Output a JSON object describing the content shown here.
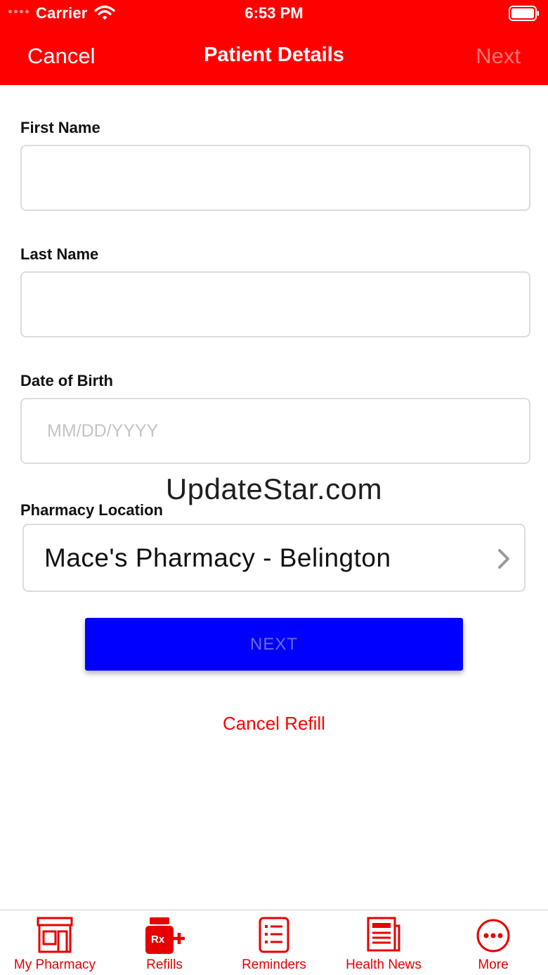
{
  "status_bar": {
    "carrier": "Carrier",
    "time": "6:53 PM"
  },
  "nav": {
    "cancel": "Cancel",
    "title": "Patient Details",
    "next": "Next"
  },
  "form": {
    "first_name": {
      "label": "First Name",
      "value": "",
      "placeholder": ""
    },
    "last_name": {
      "label": "Last Name",
      "value": "",
      "placeholder": ""
    },
    "dob": {
      "label": "Date of Birth",
      "value": "",
      "placeholder": "MM/DD/YYYY"
    },
    "pharmacy": {
      "label": "Pharmacy Location",
      "value": "Mace's Pharmacy - Belington"
    }
  },
  "watermark": "UpdateStar.com",
  "actions": {
    "next": "NEXT",
    "cancel_refill": "Cancel Refill"
  },
  "tabs": [
    {
      "label": "My Pharmacy",
      "icon": "storefront-icon"
    },
    {
      "label": "Refills",
      "icon": "rx-bottle-icon"
    },
    {
      "label": "Reminders",
      "icon": "checklist-icon"
    },
    {
      "label": "Health News",
      "icon": "newspaper-icon"
    },
    {
      "label": "More",
      "icon": "more-dots-icon"
    }
  ],
  "colors": {
    "brand": "#ff0000",
    "button": "#0000ff",
    "tab_accent": "#e60000"
  }
}
